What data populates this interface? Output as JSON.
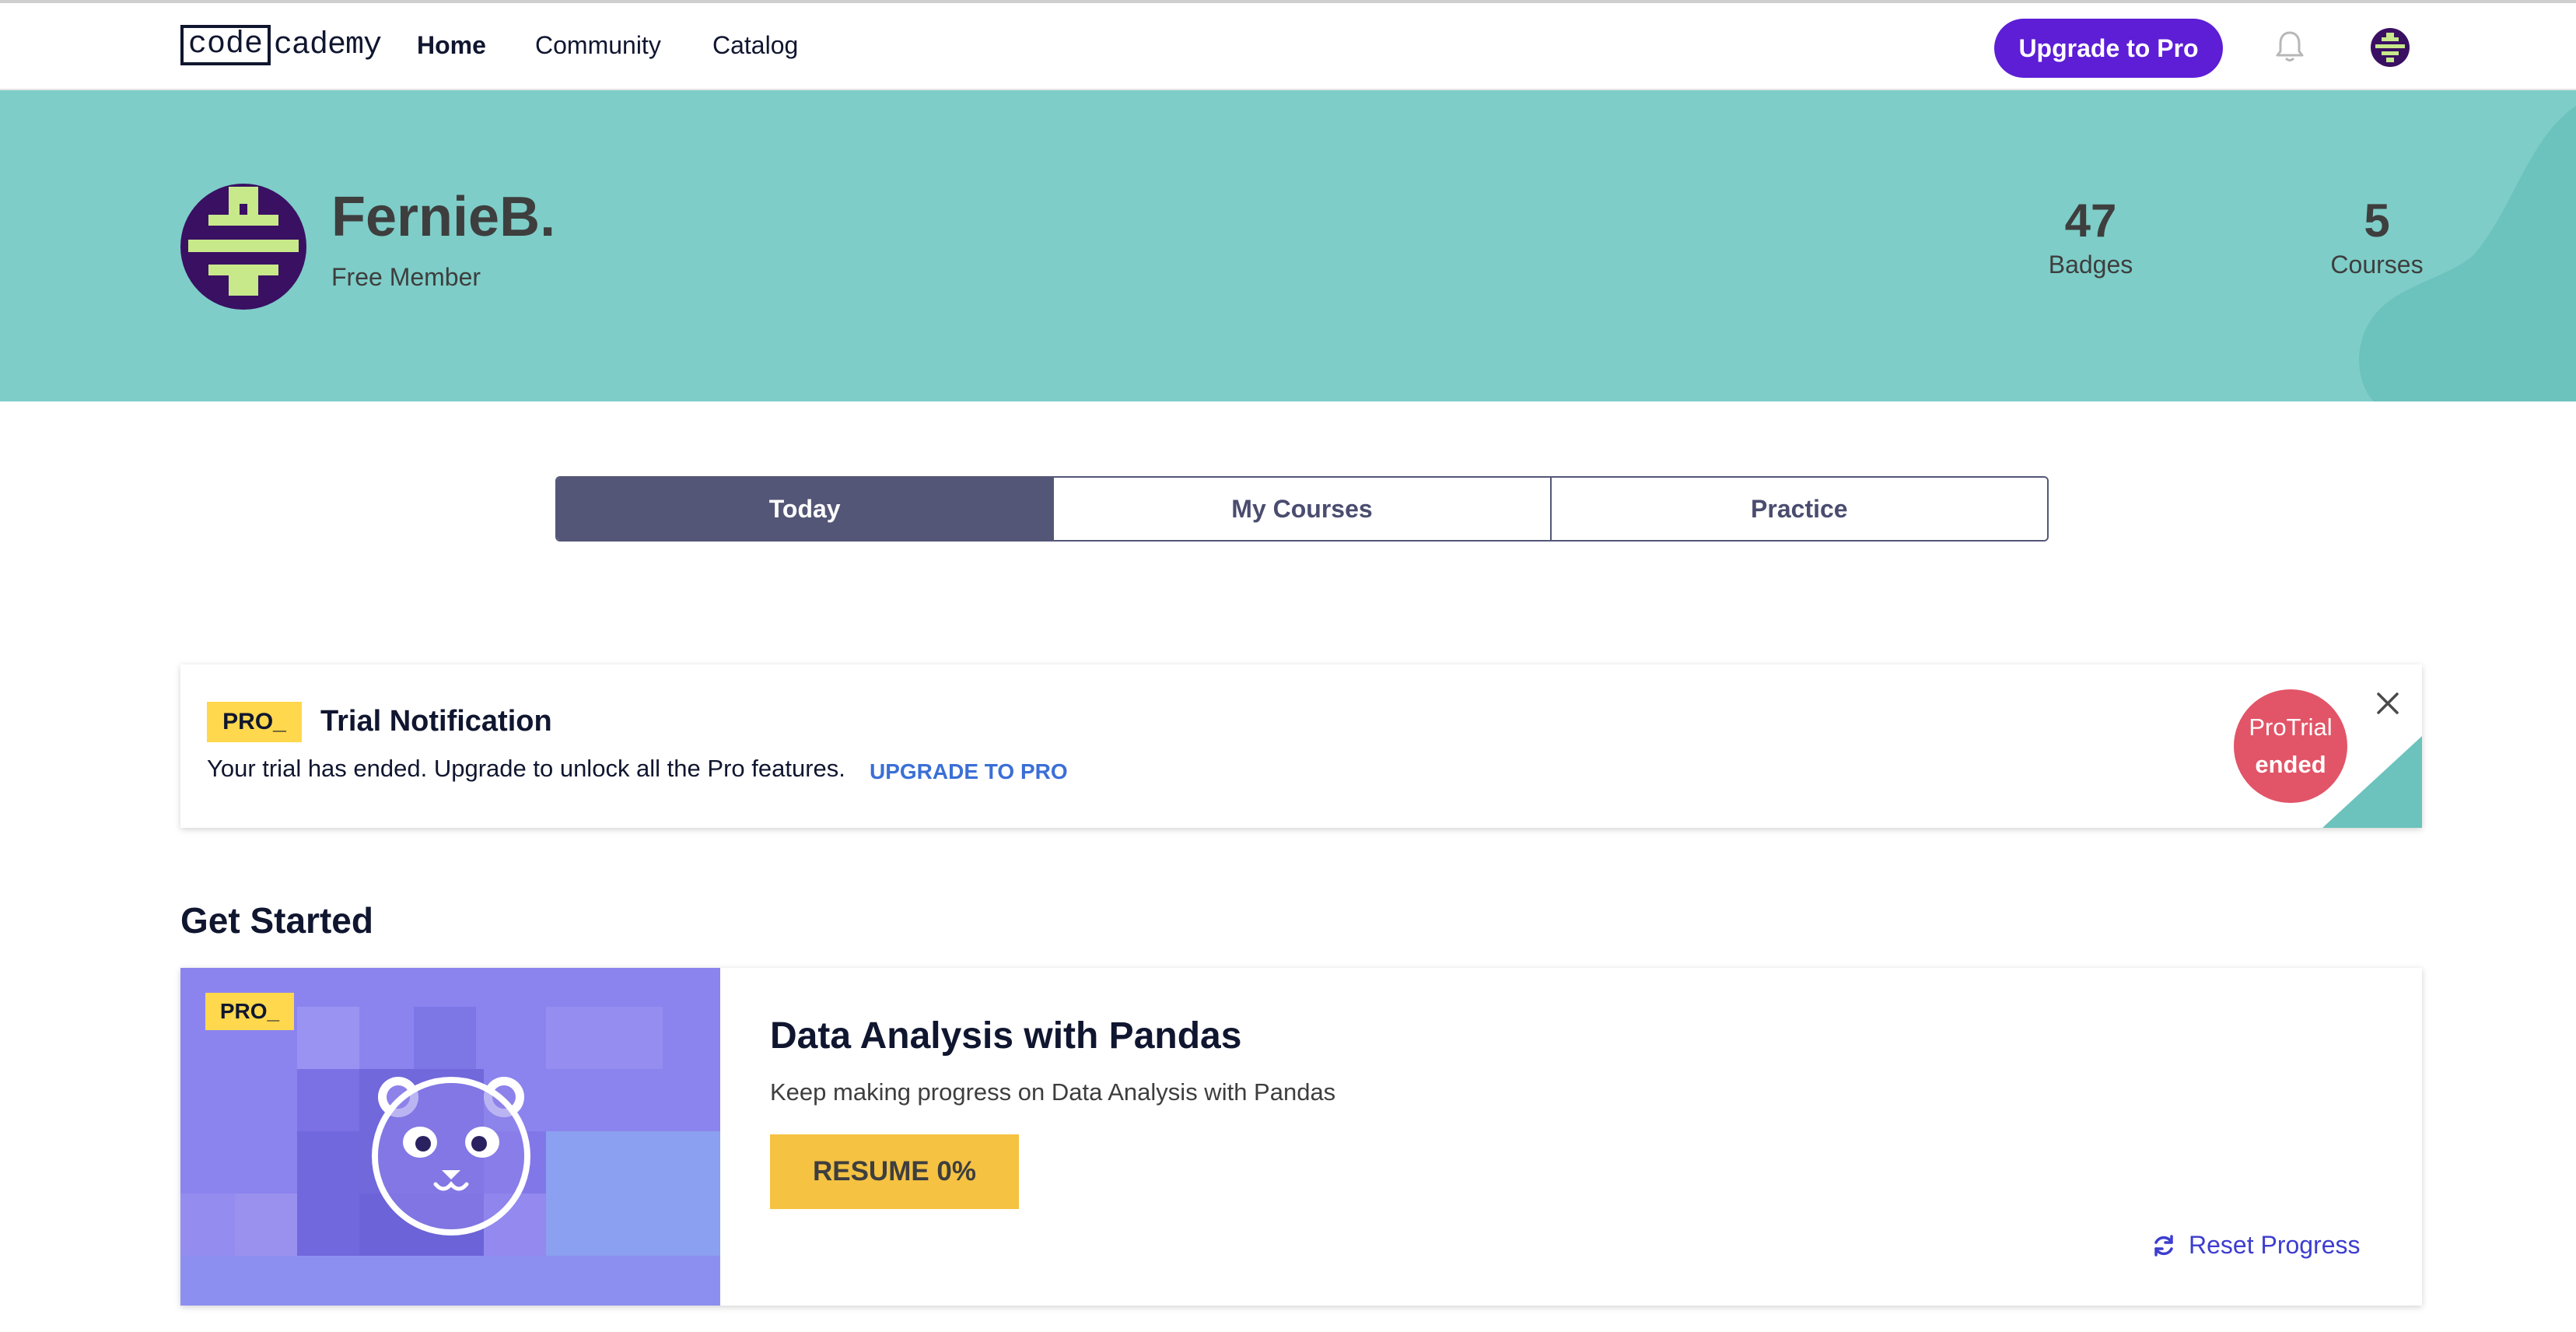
{
  "nav": {
    "logo_boxed": "code",
    "logo_rest": "cademy",
    "links": [
      "Home",
      "Community",
      "Catalog"
    ],
    "upgrade_label": "Upgrade to Pro",
    "bell_icon": "bell-icon",
    "avatar_icon": "avatar-icon"
  },
  "profile": {
    "username": "FernieB.",
    "membership": "Free Member",
    "stats": [
      {
        "value": "47",
        "label": "Badges"
      },
      {
        "value": "5",
        "label": "Courses"
      }
    ]
  },
  "tabs": [
    "Today",
    "My Courses",
    "Practice"
  ],
  "notification": {
    "badge": "PRO_",
    "title": "Trial Notification",
    "body": "Your trial has ended. Upgrade to unlock all the Pro features.",
    "link": "UPGRADE TO PRO",
    "circle_line1": "ProTrial",
    "circle_line2": "ended",
    "close_icon": "close-icon"
  },
  "get_started": {
    "title": "Get Started",
    "course": {
      "badge": "PRO_",
      "title": "Data Analysis with Pandas",
      "subtitle": "Keep making progress on Data Analysis with Pandas",
      "resume_label": "RESUME 0%",
      "progress_percent": 0,
      "reset_label": "Reset Progress",
      "reset_icon": "refresh-icon",
      "image_icon": "panda-icon"
    }
  },
  "colors": {
    "brand_purple": "#5d1ed6",
    "banner_teal": "#7ecdc8",
    "tab_active": "#545677",
    "pro_yellow": "#ffd84d",
    "resume_yellow": "#f5c242",
    "trial_red": "#e25467",
    "link_blue": "#3a6fd6",
    "reset_blue": "#3d3dd0"
  }
}
